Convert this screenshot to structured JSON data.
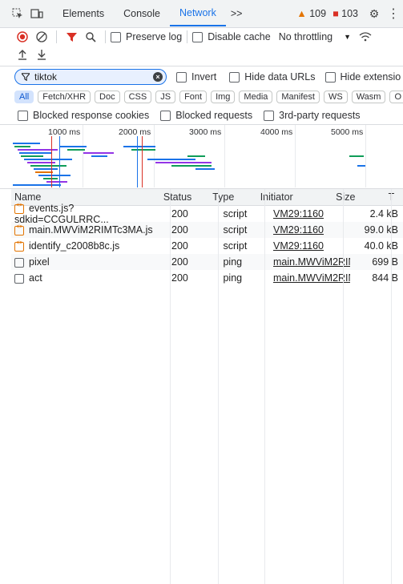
{
  "toolbar_top": {
    "tabs": [
      "Elements",
      "Console",
      "Network"
    ],
    "active_tab": "Network",
    "more": ">>",
    "warnings": "109",
    "errors": "103"
  },
  "controls": {
    "preserve_log": "Preserve log",
    "disable_cache": "Disable cache",
    "throttling": "No throttling"
  },
  "filter": {
    "value": "tiktok",
    "invert": "Invert",
    "hide_data_urls": "Hide data URLs",
    "hide_extension": "Hide extensio"
  },
  "type_filters": [
    "All",
    "Fetch/XHR",
    "Doc",
    "CSS",
    "JS",
    "Font",
    "Img",
    "Media",
    "Manifest",
    "WS",
    "Wasm",
    "O"
  ],
  "blocked": {
    "response_cookies": "Blocked response cookies",
    "requests": "Blocked requests",
    "third_party": "3rd-party requests"
  },
  "overview": {
    "ticks": [
      "1000 ms",
      "2000 ms",
      "3000 ms",
      "4000 ms",
      "5000 ms"
    ]
  },
  "table": {
    "headers": {
      "name": "Name",
      "status": "Status",
      "type": "Type",
      "initiator": "Initiator",
      "size": "Size",
      "time": "T"
    },
    "rows": [
      {
        "name": "events.js?sdkid=CCGULRRC...",
        "status": "200",
        "type": "script",
        "initiator": "VM29:1160",
        "size": "2.4 kB"
      },
      {
        "name": "main.MWViM2RIMTc3MA.js",
        "status": "200",
        "type": "script",
        "initiator": "VM29:1160",
        "size": "99.0 kB"
      },
      {
        "name": "identify_c2008b8c.js",
        "status": "200",
        "type": "script",
        "initiator": "VM29:1160",
        "size": "40.0 kB"
      },
      {
        "name": "pixel",
        "status": "200",
        "type": "ping",
        "initiator": "main.MWViM2RIN",
        "size": "699 B"
      },
      {
        "name": "act",
        "status": "200",
        "type": "ping",
        "initiator": "main.MWViM2RIN",
        "size": "844 B"
      }
    ]
  },
  "colors": {
    "accent": "#1a73e8",
    "record": "#d93025",
    "warning": "#e37400"
  }
}
